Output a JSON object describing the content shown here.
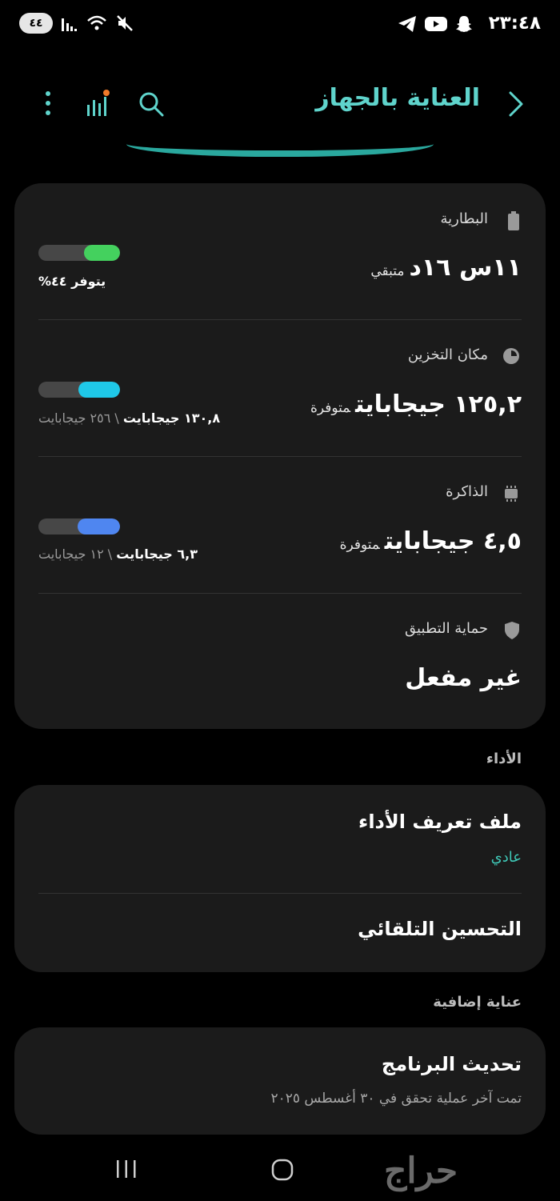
{
  "status_bar": {
    "time": "٢٣:٤٨",
    "battery_level": "٤٤",
    "icons": [
      "snapchat-icon",
      "youtube-icon",
      "telegram-icon",
      "mute-icon",
      "wifi-icon",
      "signal-icon"
    ]
  },
  "header": {
    "title": "العناية بالجهاز"
  },
  "sections": {
    "battery": {
      "label": "البطارية",
      "value": "١١س ١٦د",
      "suffix": "متبقي",
      "caption": "يتوفر ٤٤%",
      "fill_fraction": 0.44,
      "fill_color": "#44d15e"
    },
    "storage": {
      "label": "مكان التخزين",
      "value": "١٢٥,٢ جيجابايت",
      "suffix": "متوفرة",
      "caption_used": "١٣٠,٨ جيجابايت",
      "caption_total": "\\ ٢٥٦ جيجابايت",
      "fill_fraction": 0.51,
      "fill_color": "#1fc8e8"
    },
    "memory": {
      "label": "الذاكرة",
      "value": "٤,٥ جيجابايت",
      "suffix": "متوفرة",
      "caption_used": "٦,٣ جيجابايت",
      "caption_total": "\\ ١٢ جيجابايت",
      "fill_fraction": 0.52,
      "fill_color": "#4f86f0"
    },
    "app_protection": {
      "label": "حماية التطبيق",
      "value": "غير مفعل"
    }
  },
  "performance": {
    "group_title": "الأداء",
    "profile_title": "ملف تعريف الأداء",
    "profile_value": "عادي",
    "auto_optimize": "التحسين التلقائي"
  },
  "extra_care": {
    "group_title": "عناية إضافية",
    "update_title": "تحديث البرنامج",
    "update_sub": "تمت آخر عملية تحقق في ٣٠ أغسطس ٢٠٢٥"
  },
  "watermark": "حراج",
  "colors": {
    "accent": "#5fd4cc",
    "card_bg": "#1b1b1b",
    "profile_value": "#3fc9b8"
  }
}
